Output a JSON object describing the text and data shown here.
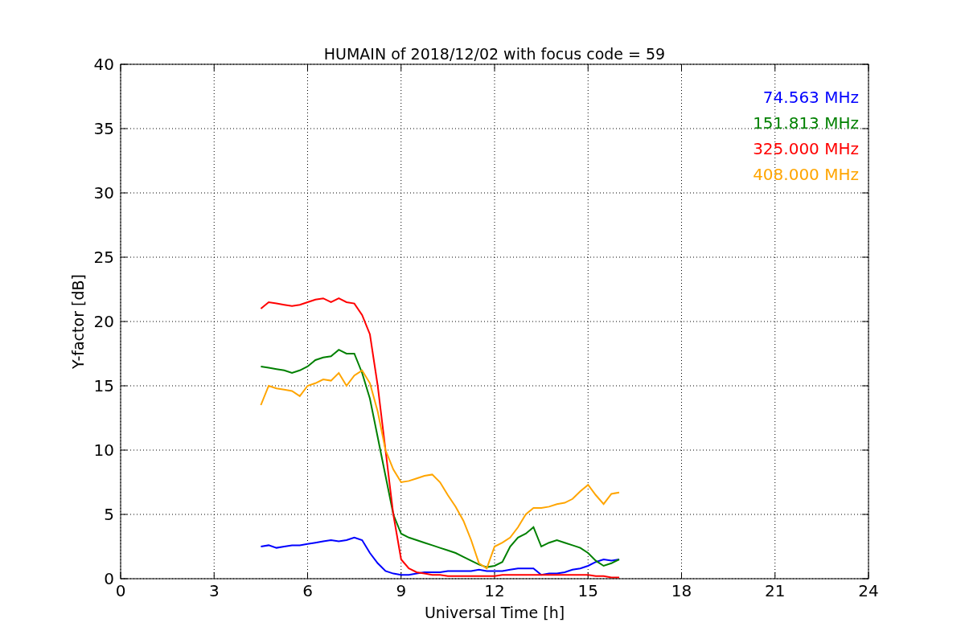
{
  "figure": {
    "chart_data": {
      "type": "line",
      "title": "HUMAIN of 2018/12/02 with focus code = 59",
      "xlabel": "Universal Time [h]",
      "ylabel": "Y-factor [dB]",
      "x": [
        4.5,
        4.75,
        5,
        5.25,
        5.5,
        5.75,
        6,
        6.25,
        6.5,
        6.75,
        7,
        7.25,
        7.5,
        7.75,
        8,
        8.25,
        8.5,
        8.75,
        9,
        9.25,
        9.5,
        9.75,
        10,
        10.25,
        10.5,
        10.75,
        11,
        11.25,
        11.5,
        11.75,
        12,
        12.25,
        12.5,
        12.75,
        13,
        13.25,
        13.5,
        13.75,
        14,
        14.25,
        14.5,
        14.75,
        15,
        15.25,
        15.5,
        15.75,
        16
      ],
      "series": [
        {
          "name": "74.563 MHz",
          "color": "#0000ff",
          "values": [
            2.5,
            2.6,
            2.4,
            2.5,
            2.6,
            2.6,
            2.7,
            2.8,
            2.9,
            3,
            2.9,
            3,
            3.2,
            3,
            2,
            1.2,
            0.6,
            0.4,
            0.3,
            0.3,
            0.4,
            0.5,
            0.5,
            0.5,
            0.6,
            0.6,
            0.6,
            0.6,
            0.7,
            0.6,
            0.6,
            0.6,
            0.7,
            0.8,
            0.8,
            0.8,
            0.3,
            0.4,
            0.4,
            0.5,
            0.7,
            0.8,
            1,
            1.3,
            1.5,
            1.4,
            1.5
          ]
        },
        {
          "name": "151.813 MHz",
          "color": "#008000",
          "values": [
            16.5,
            16.4,
            16.3,
            16.2,
            16,
            16.2,
            16.5,
            17,
            17.2,
            17.3,
            17.8,
            17.5,
            17.5,
            16,
            14,
            11,
            8,
            5,
            3.5,
            3.2,
            3,
            2.8,
            2.6,
            2.4,
            2.2,
            2,
            1.7,
            1.4,
            1.1,
            0.9,
            1,
            1.3,
            2.5,
            3.2,
            3.5,
            4,
            2.5,
            2.8,
            3,
            2.8,
            2.6,
            2.4,
            2,
            1.4,
            1,
            1.2,
            1.5
          ]
        },
        {
          "name": "325.000 MHz",
          "color": "#ff0000",
          "values": [
            21,
            21.5,
            21.4,
            21.3,
            21.2,
            21.3,
            21.5,
            21.7,
            21.8,
            21.5,
            21.8,
            21.5,
            21.4,
            20.5,
            19,
            15,
            10,
            5,
            1.5,
            0.8,
            0.5,
            0.4,
            0.3,
            0.3,
            0.2,
            0.2,
            0.2,
            0.2,
            0.2,
            0.2,
            0.2,
            0.3,
            0.3,
            0.3,
            0.3,
            0.3,
            0.3,
            0.3,
            0.3,
            0.3,
            0.3,
            0.3,
            0.3,
            0.2,
            0.2,
            0.1,
            0.1
          ]
        },
        {
          "name": "408.000 MHz",
          "color": "#ffa500",
          "values": [
            13.5,
            15,
            14.8,
            14.7,
            14.6,
            14.2,
            15,
            15.2,
            15.5,
            15.4,
            16,
            15,
            15.8,
            16.2,
            15.2,
            13,
            10,
            8.5,
            7.5,
            7.6,
            7.8,
            8,
            8.1,
            7.5,
            6.5,
            5.6,
            4.5,
            3,
            1.2,
            0.8,
            2.5,
            2.8,
            3.2,
            4,
            5,
            5.5,
            5.5,
            5.6,
            5.8,
            5.9,
            6.2,
            6.8,
            7.3,
            6.5,
            5.8,
            6.6,
            6.7
          ]
        }
      ],
      "grid": true,
      "xlim": [
        0,
        24
      ],
      "ylim": [
        0,
        40
      ],
      "xticks": [
        0,
        3,
        6,
        9,
        12,
        15,
        18,
        21,
        24
      ],
      "yticks": [
        0,
        5,
        10,
        15,
        20,
        25,
        30,
        35,
        40
      ]
    }
  }
}
